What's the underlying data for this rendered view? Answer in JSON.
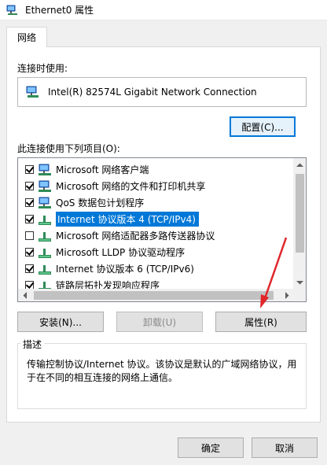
{
  "window": {
    "title": "Ethernet0 属性"
  },
  "tabs": [
    {
      "label": "网络"
    }
  ],
  "connect_using": {
    "label": "连接时使用:",
    "adapter": "Intel(R) 82574L Gigabit Network Connection",
    "configure_button": "配置(C)..."
  },
  "components": {
    "label": "此连接使用下列项目(O):",
    "items": [
      {
        "label": "Microsoft 网络客户端",
        "checked": true,
        "icon": "network-client-icon"
      },
      {
        "label": "Microsoft 网络的文件和打印机共享",
        "checked": true,
        "icon": "network-client-icon"
      },
      {
        "label": "QoS 数据包计划程序",
        "checked": true,
        "icon": "network-client-icon"
      },
      {
        "label": "Internet 协议版本 4 (TCP/IPv4)",
        "checked": true,
        "selected": true,
        "icon": "protocol-icon"
      },
      {
        "label": "Microsoft 网络适配器多路传送器协议",
        "checked": false,
        "icon": "protocol-icon"
      },
      {
        "label": "Microsoft LLDP 协议驱动程序",
        "checked": true,
        "icon": "protocol-icon"
      },
      {
        "label": "Internet 协议版本 6 (TCP/IPv6)",
        "checked": true,
        "icon": "protocol-icon"
      },
      {
        "label": "链路层拓扑发现响应程序",
        "checked": true,
        "icon": "protocol-icon"
      }
    ]
  },
  "buttons": {
    "install": "安装(N)...",
    "uninstall": "卸载(U)",
    "properties": "属性(R)",
    "ok": "确定",
    "cancel": "取消"
  },
  "description": {
    "legend": "描述",
    "text": "传输控制协议/Internet 协议。该协议是默认的广域网络协议，用于在不同的相互连接的网络上通信。"
  },
  "colors": {
    "selection": "#0078d7",
    "annotation_arrow": "#e0262b"
  }
}
